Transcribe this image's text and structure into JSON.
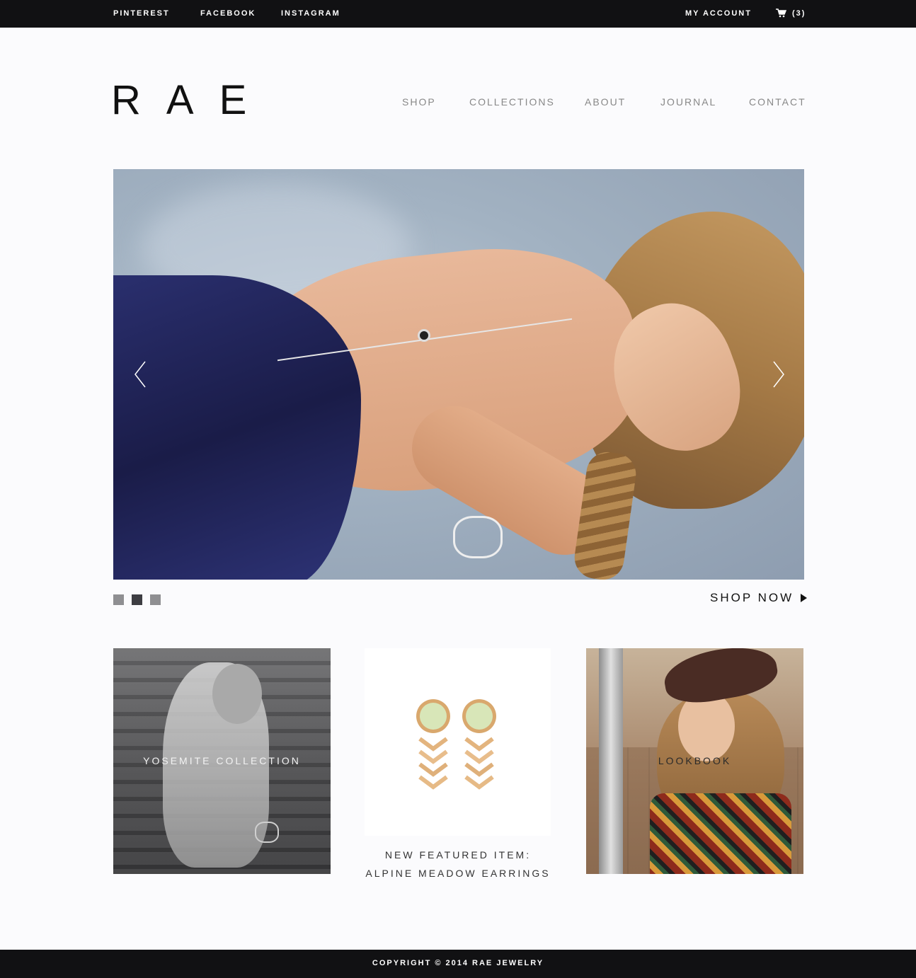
{
  "topbar": {
    "pinterest": "PINTEREST",
    "facebook": "FACEBOOK",
    "instagram": "INSTAGRAM",
    "account": "MY ACCOUNT",
    "cart_count": "(3)",
    "cart_icon": "cart-icon"
  },
  "header": {
    "logo": "RAE",
    "nav": {
      "shop": "SHOP",
      "collections": "COLLECTIONS",
      "about": "ABOUT",
      "journal": "JOURNAL",
      "contact": "CONTACT"
    }
  },
  "hero": {
    "prev_icon": "chevron-left-icon",
    "next_icon": "chevron-right-icon",
    "slide_count": 3,
    "active_slide": 2,
    "cta": "SHOP NOW",
    "cta_icon": "play-icon"
  },
  "tiles": {
    "yosemite": "YOSEMITE COLLECTION",
    "featured_line1": "NEW FEATURED ITEM:",
    "featured_line2": "ALPINE MEADOW EARRINGS",
    "lookbook": "LOOKBOOK"
  },
  "footer": {
    "copyright": "COPYRIGHT © 2014 RAE JEWELRY"
  },
  "colors": {
    "bar_background": "#111113",
    "page_background": "#fbfbfd",
    "nav_text": "#888888",
    "dot_active": "#3d3d42",
    "dot_inactive": "#8f8f92"
  }
}
